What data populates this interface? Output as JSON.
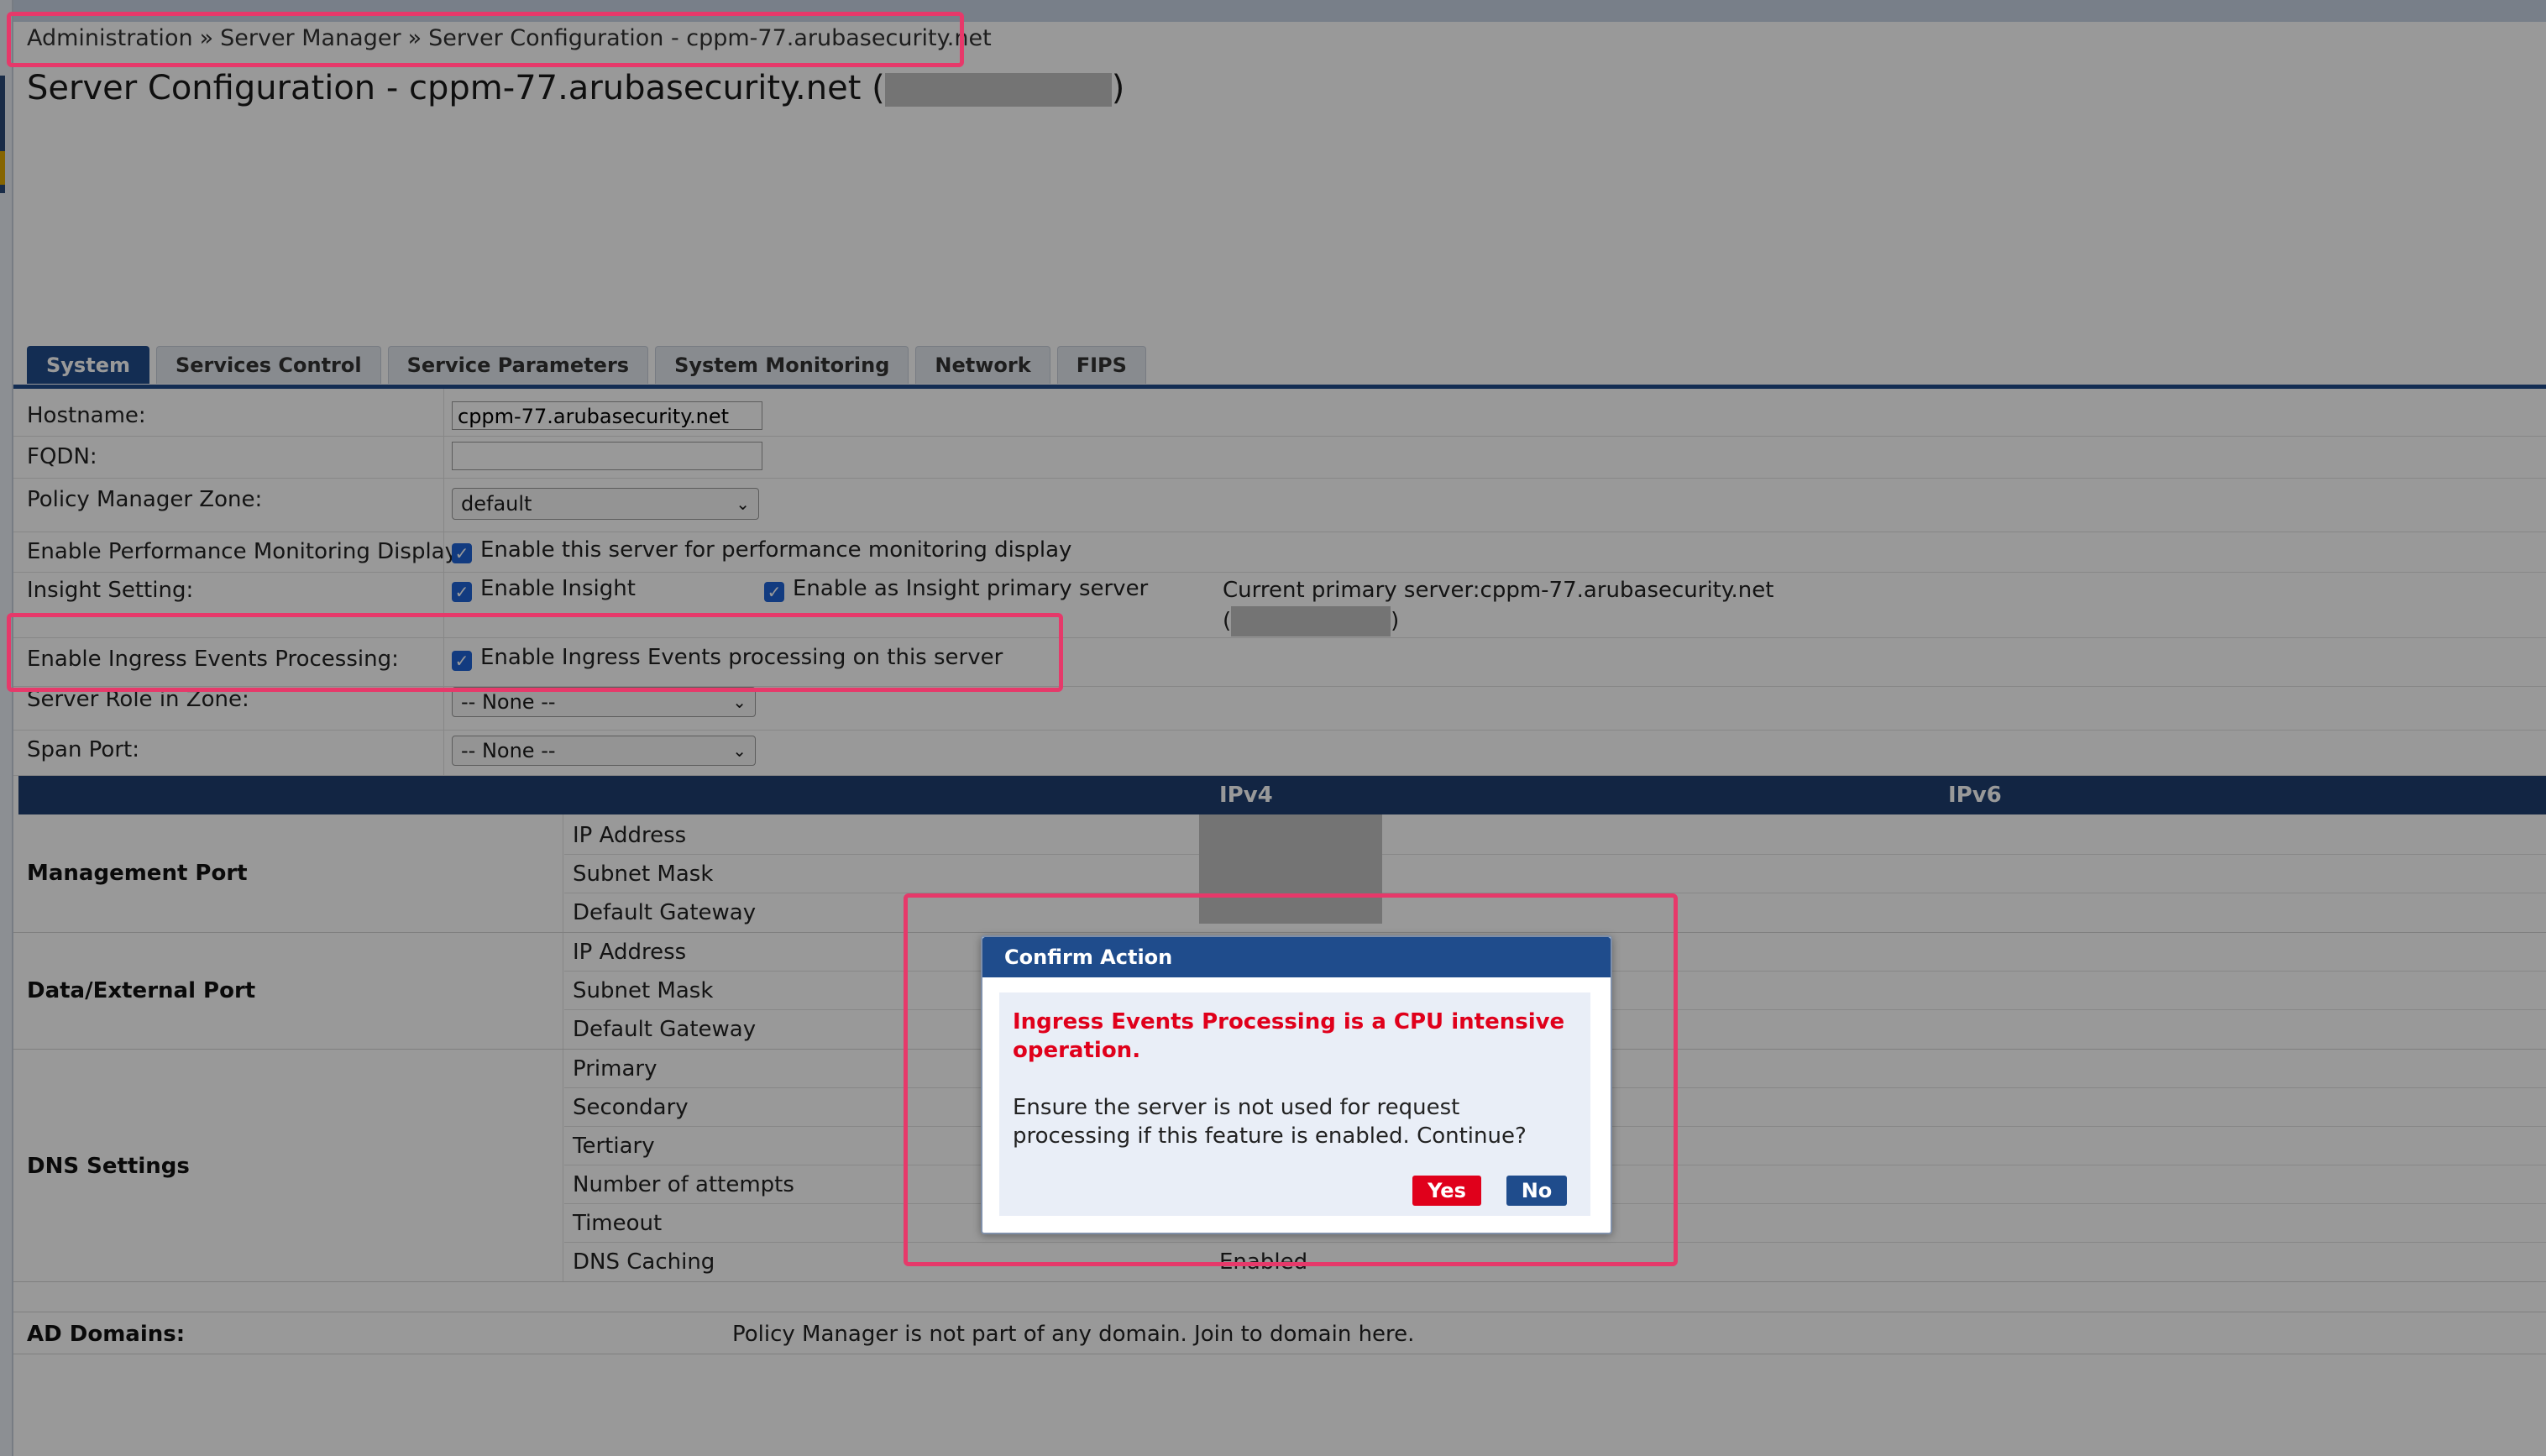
{
  "breadcrumb": {
    "item1": "Administration",
    "sep": "»",
    "item2": "Server Manager",
    "item3": "Server Configuration - cppm-77.arubasecurity.net"
  },
  "page": {
    "title_prefix": "Server Configuration - cppm-77.arubasecurity.net (",
    "title_suffix": ")"
  },
  "tabs": [
    "System",
    "Services Control",
    "Service Parameters",
    "System Monitoring",
    "Network",
    "FIPS"
  ],
  "form": {
    "hostname": {
      "label": "Hostname:",
      "value": "cppm-77.arubasecurity.net"
    },
    "fqdn": {
      "label": "FQDN:",
      "value": ""
    },
    "zone": {
      "label": "Policy Manager Zone:",
      "value": "default"
    },
    "perf": {
      "label": "Enable Performance Monitoring Display:",
      "checkbox": "Enable this server for performance monitoring display"
    },
    "insight": {
      "label": "Insight Setting:",
      "cb1": "Enable Insight",
      "cb2": "Enable as Insight primary server",
      "current": "Current primary server:cppm-77.arubasecurity.net",
      "paren_open": "(",
      "paren_close": ")"
    },
    "ingress": {
      "label": "Enable Ingress Events Processing:",
      "checkbox": "Enable Ingress Events processing on this server"
    },
    "role": {
      "label": "Server Role in Zone:",
      "value": "-- None --"
    },
    "span": {
      "label": "Span Port:",
      "value": "-- None --"
    }
  },
  "table": {
    "col_ipv4": "IPv4",
    "col_ipv6": "IPv6",
    "mgmt": {
      "label": "Management Port",
      "rows": [
        "IP Address",
        "Subnet Mask",
        "Default Gateway"
      ]
    },
    "data": {
      "label": "Data/External Port",
      "rows": [
        "IP Address",
        "Subnet Mask",
        "Default Gateway"
      ]
    },
    "dns": {
      "label": "DNS Settings",
      "rows": [
        "Primary",
        "Secondary",
        "Tertiary",
        "Number of attempts",
        "Timeout",
        "DNS Caching"
      ],
      "caching_value": "Enabled"
    }
  },
  "ad": {
    "label": "AD Domains:",
    "text": "Policy Manager is not part of any domain. Join to domain here."
  },
  "dialog": {
    "title": "Confirm Action",
    "warning": "Ingress Events Processing is a CPU intensive operation.",
    "message": "Ensure the server is not used for request processing if this feature is enabled. Continue?",
    "yes": "Yes",
    "no": "No"
  },
  "colors": {
    "accent": "#214b8a",
    "warn": "#e0001b",
    "highlight": "#e6396a"
  },
  "icons": {
    "checkbox": "checkmark-icon",
    "select": "chevron-down-icon"
  }
}
